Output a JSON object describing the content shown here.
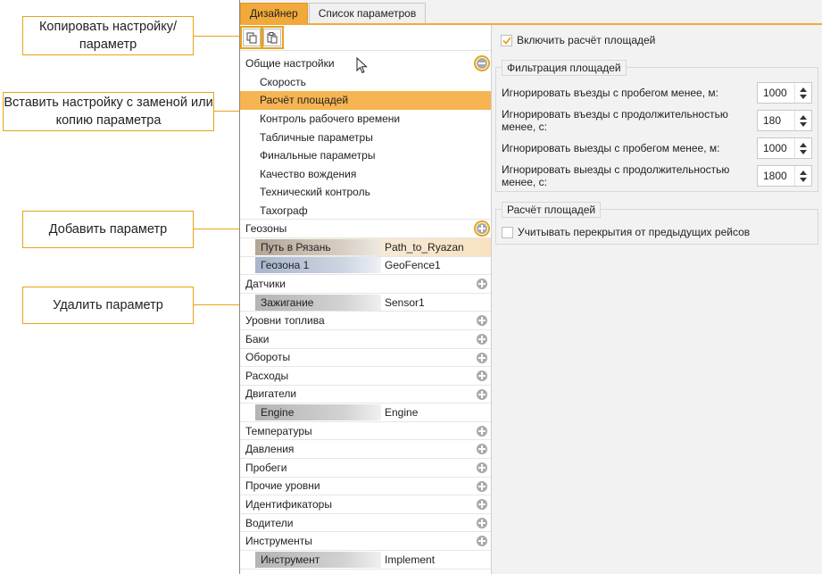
{
  "callouts": {
    "copy": "Копировать настройку/параметр",
    "paste": "Вставить настройку с заменой или копию параметра",
    "add": "Добавить параметр",
    "remove": "Удалить параметр"
  },
  "tabs": [
    "Дизайнер",
    "Список параметров"
  ],
  "tree": {
    "general": "Общие настройки",
    "general_items": [
      "Скорость",
      "Расчёт площадей",
      "Контроль рабочего времени",
      "Табличные параметры",
      "Финальные параметры",
      "Качество вождения",
      "Технический контроль",
      "Тахограф"
    ],
    "geozones": "Геозоны",
    "geozone_params": [
      {
        "name": "Путь в Рязань",
        "value": "Path_to_Ryazan"
      },
      {
        "name": "Геозона 1",
        "value": "GeoFence1"
      }
    ],
    "sensors": "Датчики",
    "sensor_params": [
      {
        "name": "Зажигание",
        "value": "Sensor1"
      }
    ],
    "group_a": [
      "Уровни топлива",
      "Баки",
      "Обороты",
      "Расходы",
      "Двигатели"
    ],
    "engine_params": [
      {
        "name": "Engine",
        "value": "Engine"
      }
    ],
    "group_b": [
      "Температуры",
      "Давления",
      "Пробеги",
      "Прочие уровни",
      "Идентификаторы",
      "Водители",
      "Инструменты"
    ],
    "tool_params": [
      {
        "name": "Инструмент",
        "value": "Implement"
      }
    ]
  },
  "panel": {
    "enable_label": "Включить расчёт площадей",
    "filter_title": "Фильтрация площадей",
    "filters": [
      {
        "label": "Игнорировать въезды с пробегом менее, м:",
        "value": "1000"
      },
      {
        "label": "Игнорировать въезды с продолжительностью менее, с:",
        "value": "180"
      },
      {
        "label": "Игнорировать выезды с пробегом менее, м:",
        "value": "1000"
      },
      {
        "label": "Игнорировать выезды с продолжительностью менее, с:",
        "value": "1800"
      }
    ],
    "calc_title": "Расчёт площадей",
    "overlap_label": "Учитывать перекрытия от предыдущих рейсов"
  },
  "colors": {
    "accent": "#f2a93b",
    "callout_border": "#e8a317",
    "selected_row": "#f6b552"
  }
}
